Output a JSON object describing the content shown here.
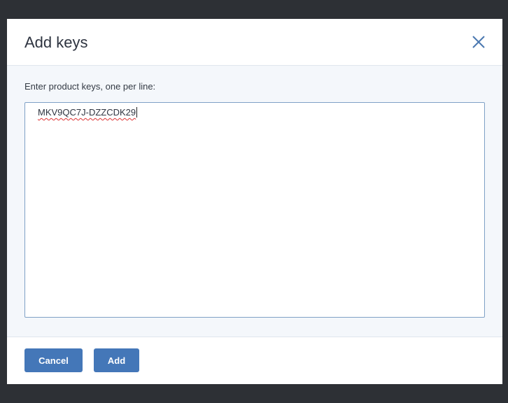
{
  "dialog": {
    "title": "Add keys",
    "close_icon": "close-x-icon",
    "label": "Enter product keys, one per line:",
    "textarea_value": "MKV9QC7J-DZZCDK29",
    "cancel_label": "Cancel",
    "add_label": "Add"
  },
  "colors": {
    "accent": "#4477b8",
    "backdrop": "#2d3035",
    "body_bg": "#f4f7fb"
  }
}
